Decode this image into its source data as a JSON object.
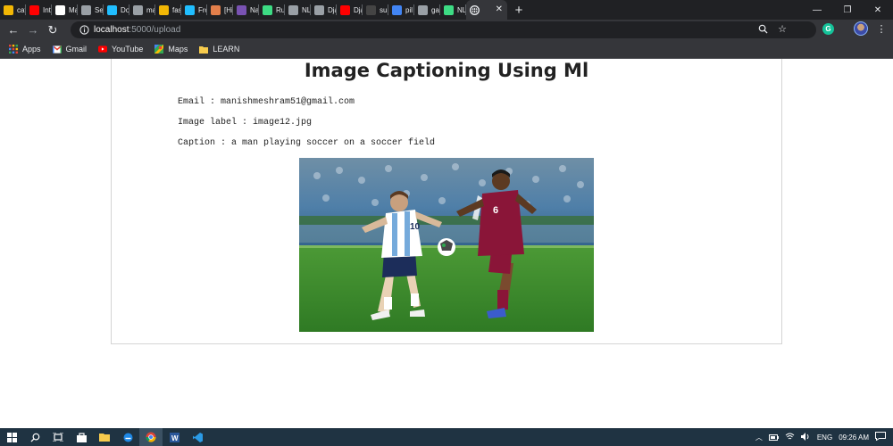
{
  "browser": {
    "tabs": [
      {
        "label": "cat_",
        "icon": "emoji-icon",
        "color": "#f2b705"
      },
      {
        "label": "Intr",
        "icon": "youtube-icon",
        "color": "#ff0000"
      },
      {
        "label": "Ma",
        "icon": "app-icon",
        "color": "#ffffff"
      },
      {
        "label": "See",
        "icon": "globe-icon",
        "color": "#9aa0a6"
      },
      {
        "label": "Do",
        "icon": "kaggle-icon",
        "color": "#20beff"
      },
      {
        "label": "ma",
        "icon": "image-icon",
        "color": "#9aa0a6"
      },
      {
        "label": "fash",
        "icon": "emoji-icon",
        "color": "#f2b705"
      },
      {
        "label": "Fro",
        "icon": "kaggle-icon",
        "color": "#20beff"
      },
      {
        "label": "[Hir",
        "icon": "avatar-icon",
        "color": "#e37f4b"
      },
      {
        "label": "Nav",
        "icon": "bootstrap-icon",
        "color": "#7952b3"
      },
      {
        "label": "Run",
        "icon": "android-icon",
        "color": "#3ddc84"
      },
      {
        "label": "NLF",
        "icon": "globe-icon",
        "color": "#9aa0a6"
      },
      {
        "label": "Dja",
        "icon": "image-icon",
        "color": "#9aa0a6"
      },
      {
        "label": "Dja",
        "icon": "youtube-icon",
        "color": "#ff0000"
      },
      {
        "label": "sun",
        "icon": "github-icon",
        "color": "#444444"
      },
      {
        "label": "pil",
        "icon": "google-icon",
        "color": "#4285f4"
      },
      {
        "label": "gal",
        "icon": "globe-icon",
        "color": "#9aa0a6"
      },
      {
        "label": "NLF",
        "icon": "vine-icon",
        "color": "#3ddc84"
      }
    ],
    "active_tab": {
      "label": "",
      "icon": "globe-icon"
    },
    "new_tab": "+",
    "url_host": "localhost",
    "url_path": ":5000/upload"
  },
  "bookmarks": [
    {
      "label": "Apps",
      "icon": "apps-grid-icon"
    },
    {
      "label": "Gmail",
      "icon": "gmail-icon"
    },
    {
      "label": "YouTube",
      "icon": "youtube-icon"
    },
    {
      "label": "Maps",
      "icon": "maps-icon"
    },
    {
      "label": "LEARN",
      "icon": "folder-icon"
    }
  ],
  "page": {
    "title": "Image Captioning Using Ml",
    "email_line": "Email : manishmeshram51@gmail.com",
    "label_line": "Image label : image12.jpg",
    "caption_line": "Caption : a man playing soccer on a soccer field"
  },
  "taskbar": {
    "language": "ENG",
    "time": "09:26 AM"
  },
  "colors": {
    "tab_strip": "#202124",
    "toolbar": "#35363a",
    "taskbar": "#1f3342",
    "argentina_white": "#ffffff",
    "argentina_blue": "#75aadb",
    "qatar_maroon": "#8a1538",
    "pitch_green": "#3f8a2f"
  }
}
